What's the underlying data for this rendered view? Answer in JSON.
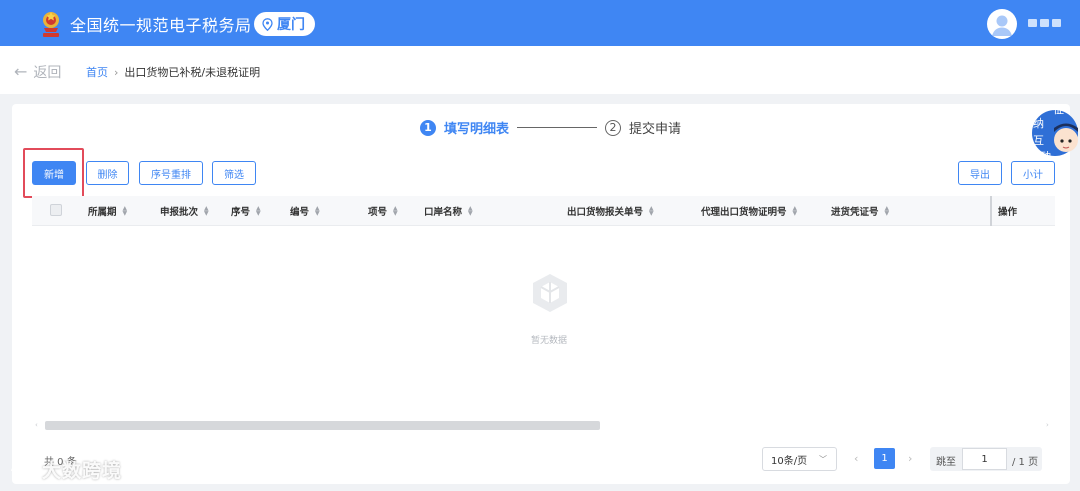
{
  "header": {
    "site_title": "全国统一规范电子税务局",
    "city": "厦门",
    "colors": {
      "brand": "#3f86f3"
    }
  },
  "breadcrumb": {
    "back_label": "返回",
    "home": "首页",
    "separator": "›",
    "current": "出口货物已补税/未退税证明"
  },
  "steps": [
    {
      "number": "1",
      "label": "填写明细表",
      "active": true
    },
    {
      "number": "2",
      "label": "提交申请",
      "active": false
    }
  ],
  "mascot_text": "征纳互动",
  "toolbar": {
    "add": "新增",
    "delete": "删除",
    "reorder": "序号重排",
    "filter": "筛选",
    "export": "导出",
    "subtotal": "小计"
  },
  "table": {
    "columns": [
      "所属期",
      "申报批次",
      "序号",
      "编号",
      "项号",
      "口岸名称",
      "出口货物报关单号",
      "代理出口货物证明号",
      "进货凭证号",
      "操作"
    ],
    "rows": [],
    "empty_text": "暂无数据"
  },
  "pagination": {
    "total": "共 0 条",
    "page_size": "10条/页",
    "current_page": "1",
    "jump_label": "跳至",
    "jump_value": "1",
    "total_pages": "/ 1 页"
  },
  "watermark": "大数跨境"
}
